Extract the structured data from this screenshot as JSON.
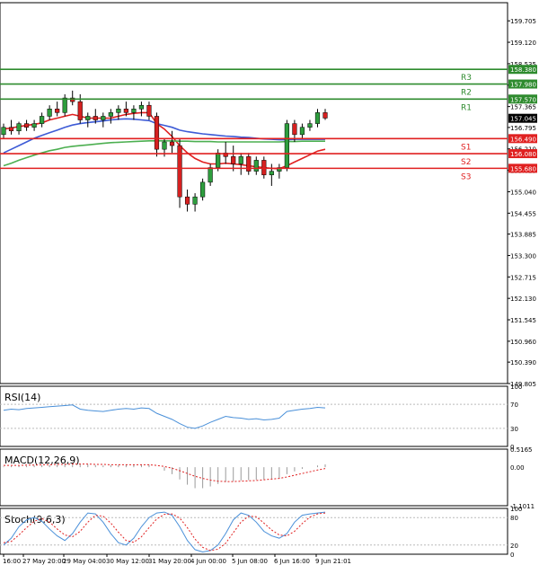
{
  "chart_data": {
    "type": "candlestick",
    "y_axis_labels": [
      "159.705",
      "159.120",
      "158.535",
      "157.950",
      "157.365",
      "156.795",
      "156.210",
      "155.625",
      "155.040",
      "154.455",
      "153.885",
      "153.300",
      "152.715",
      "152.130",
      "151.545",
      "150.960",
      "150.390",
      "149.805"
    ],
    "price_ylim": [
      149.805,
      160.2
    ],
    "x_axis_labels": [
      "16:00",
      "27 May 20:00",
      "29 May 04:00",
      "30 May 12:00",
      "31 May 20:00",
      "4 Jun 00:00",
      "5 Jun 08:00",
      "6 Jun 16:00",
      "9 Jun 21:01"
    ],
    "levels": [
      {
        "name": "R3",
        "value": 158.38,
        "label": "158.380",
        "color": "#2e8b2e"
      },
      {
        "name": "R2",
        "value": 157.98,
        "label": "157.980",
        "color": "#2e8b2e"
      },
      {
        "name": "R1",
        "value": 157.57,
        "label": "157.570",
        "color": "#2e8b2e"
      },
      {
        "name": "S1",
        "value": 156.49,
        "label": "156.490",
        "color": "#e02020"
      },
      {
        "name": "S2",
        "value": 156.08,
        "label": "156.080",
        "color": "#e02020"
      },
      {
        "name": "S3",
        "value": 155.68,
        "label": "155.680",
        "color": "#e02020"
      }
    ],
    "current_price": {
      "value": 157.045,
      "label": "157.045"
    },
    "candles": [
      [
        156.6,
        156.9,
        156.5,
        156.8
      ],
      [
        156.8,
        157.0,
        156.6,
        156.7
      ],
      [
        156.7,
        156.95,
        156.6,
        156.9
      ],
      [
        156.9,
        157.0,
        156.7,
        156.8
      ],
      [
        156.8,
        157.0,
        156.7,
        156.9
      ],
      [
        156.9,
        157.2,
        156.8,
        157.1
      ],
      [
        157.1,
        157.4,
        157.0,
        157.3
      ],
      [
        157.3,
        157.5,
        157.1,
        157.2
      ],
      [
        157.2,
        157.7,
        157.1,
        157.6
      ],
      [
        157.6,
        157.8,
        157.4,
        157.5
      ],
      [
        157.5,
        157.7,
        156.9,
        157.0
      ],
      [
        157.0,
        157.2,
        156.8,
        157.1
      ],
      [
        157.1,
        157.3,
        156.9,
        157.0
      ],
      [
        157.0,
        157.2,
        156.8,
        157.1
      ],
      [
        157.1,
        157.3,
        156.9,
        157.2
      ],
      [
        157.2,
        157.4,
        157.0,
        157.3
      ],
      [
        157.3,
        157.5,
        157.1,
        157.2
      ],
      [
        157.2,
        157.4,
        157.0,
        157.3
      ],
      [
        157.3,
        157.5,
        157.1,
        157.4
      ],
      [
        157.4,
        157.5,
        157.0,
        157.1
      ],
      [
        157.1,
        157.2,
        156.0,
        156.2
      ],
      [
        156.2,
        156.5,
        156.0,
        156.4
      ],
      [
        156.4,
        156.7,
        156.1,
        156.3
      ],
      [
        156.3,
        156.5,
        154.6,
        154.9
      ],
      [
        154.9,
        155.1,
        154.5,
        154.7
      ],
      [
        154.7,
        155.0,
        154.5,
        154.9
      ],
      [
        154.9,
        155.4,
        154.8,
        155.3
      ],
      [
        155.3,
        155.8,
        155.2,
        155.7
      ],
      [
        155.7,
        156.2,
        155.6,
        156.1
      ],
      [
        156.1,
        156.4,
        155.8,
        156.0
      ],
      [
        156.0,
        156.3,
        155.6,
        155.8
      ],
      [
        155.8,
        156.1,
        155.5,
        156.0
      ],
      [
        156.0,
        156.1,
        155.5,
        155.6
      ],
      [
        155.6,
        156.0,
        155.5,
        155.9
      ],
      [
        155.9,
        156.0,
        155.4,
        155.5
      ],
      [
        155.5,
        155.8,
        155.2,
        155.6
      ],
      [
        155.6,
        155.8,
        155.4,
        155.7
      ],
      [
        155.7,
        157.0,
        155.6,
        156.9
      ],
      [
        156.9,
        157.0,
        156.4,
        156.6
      ],
      [
        156.6,
        156.9,
        156.5,
        156.8
      ],
      [
        156.8,
        157.0,
        156.7,
        156.9
      ],
      [
        156.9,
        157.3,
        156.8,
        157.2
      ],
      [
        157.2,
        157.3,
        157.0,
        157.05
      ]
    ],
    "series": [
      {
        "name": "",
        "type": "line",
        "color": "#e02020",
        "values": [
          156.75,
          156.78,
          156.82,
          156.85,
          156.88,
          156.92,
          157.0,
          157.05,
          157.1,
          157.15,
          157.1,
          157.05,
          157.05,
          157.05,
          157.05,
          157.1,
          157.15,
          157.18,
          157.2,
          157.2,
          156.9,
          156.75,
          156.55,
          156.3,
          156.1,
          155.95,
          155.85,
          155.8,
          155.8,
          155.82,
          155.8,
          155.78,
          155.75,
          155.72,
          155.7,
          155.68,
          155.67,
          155.75,
          155.85,
          155.95,
          156.05,
          156.15,
          156.2
        ]
      },
      {
        "name": "",
        "type": "line",
        "color": "#3d5bd6",
        "values": [
          156.1,
          156.2,
          156.3,
          156.4,
          156.5,
          156.58,
          156.65,
          156.72,
          156.8,
          156.86,
          156.9,
          156.93,
          156.95,
          156.97,
          157.0,
          157.02,
          157.03,
          157.02,
          157.0,
          156.98,
          156.9,
          156.85,
          156.8,
          156.72,
          156.68,
          156.65,
          156.62,
          156.6,
          156.58,
          156.56,
          156.55,
          156.53,
          156.52,
          156.5,
          156.48,
          156.47,
          156.46,
          156.46,
          156.47,
          156.47,
          156.47,
          156.47,
          156.47
        ]
      },
      {
        "name": "",
        "type": "line",
        "color": "#4caf50",
        "values": [
          155.75,
          155.82,
          155.9,
          155.97,
          156.04,
          156.1,
          156.16,
          156.2,
          156.25,
          156.28,
          156.3,
          156.32,
          156.34,
          156.36,
          156.38,
          156.39,
          156.4,
          156.41,
          156.42,
          156.43,
          156.43,
          156.43,
          156.43,
          156.42,
          156.42,
          156.41,
          156.41,
          156.41,
          156.4,
          156.4,
          156.4,
          156.4,
          156.4,
          156.4,
          156.4,
          156.4,
          156.4,
          156.41,
          156.41,
          156.42,
          156.42,
          156.42,
          156.42
        ]
      }
    ],
    "indicators": [
      {
        "name": "RSI(14)",
        "ticks": [
          "100",
          "70",
          "30",
          "0"
        ],
        "ylim": [
          0,
          100
        ],
        "line_color": "#4a90d9",
        "values": [
          60,
          62,
          61,
          63,
          64,
          65,
          66,
          67,
          68,
          69,
          62,
          60,
          59,
          58,
          60,
          62,
          63,
          62,
          64,
          63,
          55,
          50,
          45,
          38,
          32,
          30,
          34,
          40,
          45,
          50,
          48,
          47,
          45,
          46,
          44,
          45,
          47,
          58,
          60,
          62,
          63,
          65,
          64
        ]
      },
      {
        "name": "MACD(12,26,9)",
        "ticks": [
          "0.5165",
          "0.00",
          "-1.1011"
        ],
        "ylim": [
          -1.1011,
          0.5165
        ],
        "hist_color": "#9a9a9a",
        "signal_color": "#e02020",
        "hist": [
          0.02,
          0.03,
          0.03,
          0.04,
          0.05,
          0.06,
          0.07,
          0.09,
          0.1,
          0.11,
          0.09,
          0.08,
          0.06,
          0.05,
          0.06,
          0.07,
          0.08,
          0.08,
          0.08,
          0.07,
          0.0,
          -0.1,
          -0.2,
          -0.35,
          -0.5,
          -0.6,
          -0.6,
          -0.55,
          -0.48,
          -0.42,
          -0.4,
          -0.38,
          -0.37,
          -0.36,
          -0.35,
          -0.34,
          -0.33,
          -0.2,
          -0.12,
          -0.05,
          0.0,
          0.05,
          0.08
        ],
        "signal": [
          0.05,
          0.05,
          0.05,
          0.06,
          0.06,
          0.07,
          0.07,
          0.08,
          0.08,
          0.09,
          0.09,
          0.09,
          0.08,
          0.08,
          0.07,
          0.07,
          0.07,
          0.07,
          0.07,
          0.07,
          0.05,
          0.02,
          -0.03,
          -0.1,
          -0.18,
          -0.26,
          -0.32,
          -0.37,
          -0.4,
          -0.41,
          -0.41,
          -0.4,
          -0.39,
          -0.38,
          -0.36,
          -0.34,
          -0.32,
          -0.28,
          -0.23,
          -0.18,
          -0.13,
          -0.08,
          -0.04
        ]
      },
      {
        "name": "Stoch(9,6,3)",
        "ticks": [
          "100",
          "80",
          "20",
          "0"
        ],
        "ylim": [
          0,
          100
        ],
        "main_color": "#4a90d9",
        "signal_color": "#e02020",
        "main": [
          20,
          35,
          60,
          75,
          80,
          72,
          55,
          40,
          30,
          45,
          70,
          90,
          88,
          70,
          45,
          25,
          20,
          35,
          60,
          80,
          90,
          92,
          85,
          60,
          30,
          10,
          5,
          8,
          20,
          45,
          75,
          90,
          85,
          70,
          50,
          40,
          35,
          45,
          70,
          85,
          88,
          90,
          92
        ],
        "signal": [
          25,
          28,
          42,
          58,
          72,
          78,
          70,
          55,
          42,
          38,
          50,
          70,
          85,
          83,
          68,
          48,
          30,
          26,
          38,
          58,
          77,
          87,
          88,
          79,
          58,
          33,
          15,
          8,
          11,
          24,
          47,
          70,
          83,
          82,
          68,
          53,
          42,
          40,
          50,
          67,
          81,
          88,
          90
        ]
      }
    ]
  }
}
